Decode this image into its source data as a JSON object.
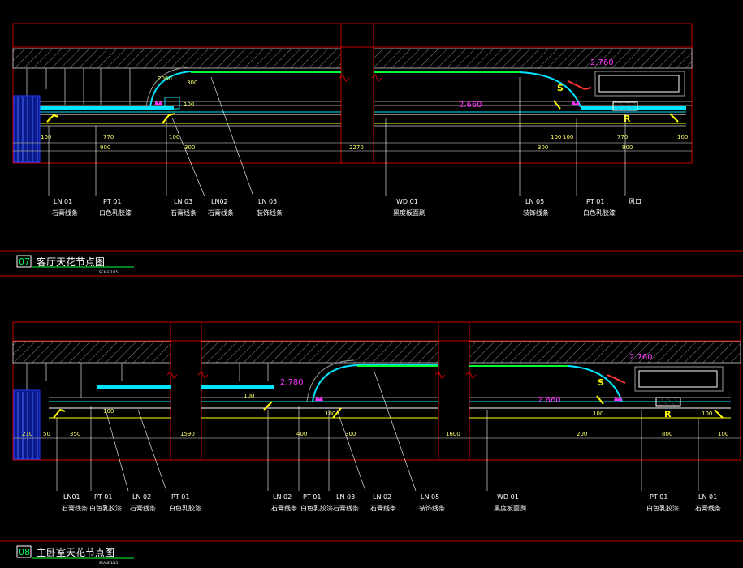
{
  "colors": {
    "background": "#000000",
    "frame": "#cc0000",
    "hatch": "#8a8a8a",
    "cyan": "#00e5ff",
    "green": "#00ff33",
    "yellow": "#ffff00",
    "white": "#ffffff",
    "magenta": "#ff33ff",
    "blue": "#1e3cff",
    "grey": "#9a9a9a"
  },
  "section1": {
    "number": "07",
    "title": "客厅天花节点图",
    "scale": "SCALE 1/15",
    "dims": [
      "100",
      "770",
      "900",
      "2060",
      "100",
      "300",
      "300",
      "2270",
      "300",
      "100",
      "100",
      "770",
      "900",
      "100",
      "100",
      "300"
    ],
    "levels": {
      "a": "2.660",
      "b": "2.760",
      "c": "2.660"
    },
    "marks": {
      "s": "S",
      "r": "R"
    },
    "labels": [
      {
        "code": "LN 01",
        "name": "石膏线条"
      },
      {
        "code": "PT 01",
        "name": "白色乳胶漆"
      },
      {
        "code": "LN 03",
        "name": "石膏线条"
      },
      {
        "code": "LN02",
        "name": "石膏线条"
      },
      {
        "code": "LN 05",
        "name": "装饰线条"
      },
      {
        "code": "WD 01",
        "name": "黑度板面刷"
      },
      {
        "code": "LN 05",
        "name": "装饰线条"
      },
      {
        "code": "PT 01",
        "name": "白色乳胶漆"
      },
      {
        "code": "",
        "name": "风口"
      }
    ]
  },
  "section2": {
    "number": "08",
    "title": "主卧室天花节点图",
    "scale": "SCALE 1/15",
    "dims": [
      "210",
      "50",
      "350",
      "100",
      "1590",
      "400",
      "300",
      "100",
      "1600",
      "200",
      "800",
      "100",
      "100",
      "100",
      "100"
    ],
    "levels": {
      "a": "2.780",
      "b": "2.660",
      "c": "2.760"
    },
    "marks": {
      "s": "S",
      "r": "R"
    },
    "labels": [
      {
        "code": "LN01",
        "name": "石膏线条"
      },
      {
        "code": "PT 01",
        "name": "白色乳胶漆"
      },
      {
        "code": "LN 02",
        "name": "石膏线条"
      },
      {
        "code": "PT 01",
        "name": "白色乳胶漆"
      },
      {
        "code": "LN 02",
        "name": "石膏线条"
      },
      {
        "code": "PT 01",
        "name": "白色乳胶漆"
      },
      {
        "code": "LN 03",
        "name": "石膏线条"
      },
      {
        "code": "LN 02",
        "name": "石膏线条"
      },
      {
        "code": "LN 05",
        "name": "装饰线条"
      },
      {
        "code": "WD 01",
        "name": "黑度板面刷"
      },
      {
        "code": "PT 01",
        "name": "白色乳胶漆"
      },
      {
        "code": "LN 01",
        "name": "石膏线条"
      }
    ]
  }
}
